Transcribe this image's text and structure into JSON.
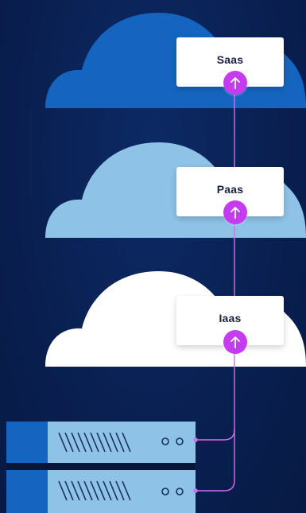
{
  "diagram": {
    "layers": [
      {
        "label": "Saas",
        "icon": "arrow-up-icon",
        "cloud_color": "#1565c0"
      },
      {
        "label": "Paas",
        "icon": "arrow-up-icon",
        "cloud_color": "#8ec2e6"
      },
      {
        "label": "Iaas",
        "icon": "arrow-up-icon",
        "cloud_color": "#ffffff"
      }
    ],
    "connector_color": "#d46ff0",
    "accent_color": "#c53cf0",
    "server_icon": "server-rack-icon"
  }
}
